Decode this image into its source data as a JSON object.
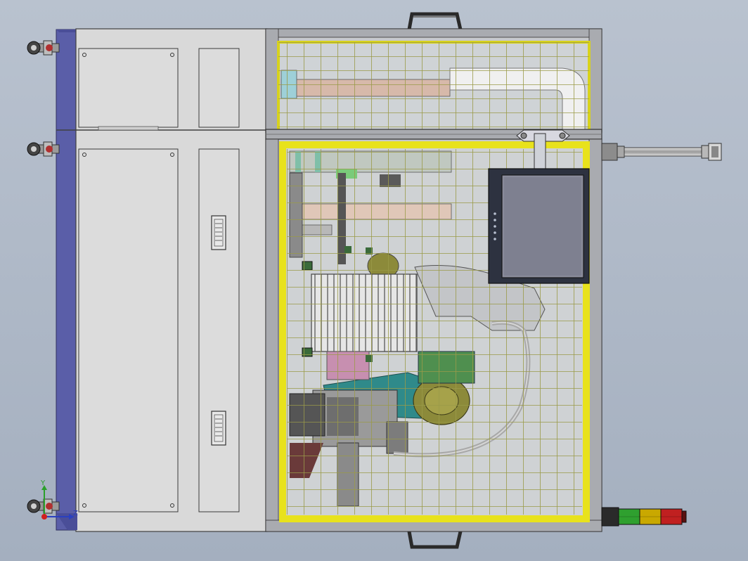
{
  "viewport": {
    "background_top": "#b9c2cf",
    "background_bottom": "#a4afbf"
  },
  "colors": {
    "cabinet_panel": "#dcdcdc",
    "cabinet_edge": "#5a5ea8",
    "frame_gray": "#8c9096",
    "guard_yellow": "#e8e21c",
    "mesh_wire": "#8a8a4a",
    "monitor_bezel": "#2d3240",
    "monitor_screen": "#7e8090",
    "robot_teal": "#2f8a8a",
    "robot_olive": "#8c8a3a",
    "tower_green": "#2fa02f",
    "tower_amber": "#c9a800",
    "tower_red": "#c02020"
  },
  "triad": {
    "y_label": "Y",
    "z_label": "Z"
  }
}
